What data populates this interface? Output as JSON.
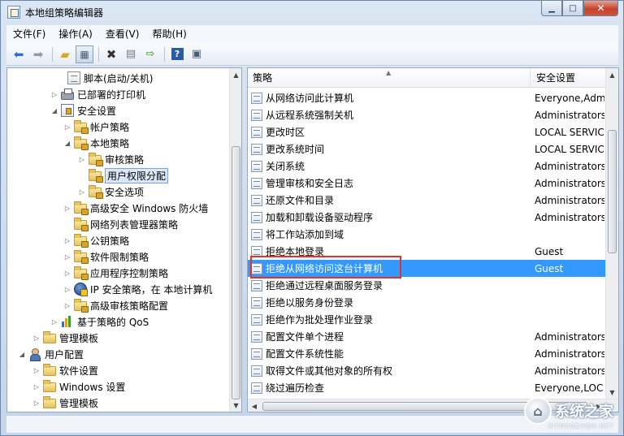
{
  "window": {
    "title": "本地组策略编辑器"
  },
  "menu": [
    {
      "label": "文件(F)"
    },
    {
      "label": "操作(A)"
    },
    {
      "label": "查看(V)"
    },
    {
      "label": "帮助(H)"
    }
  ],
  "toolbar": {
    "buttons": [
      "back-icon",
      "forward-icon",
      "up-folder-icon",
      "show-tree-icon",
      "delete-icon",
      "properties-icon",
      "export-icon",
      "help-icon",
      "view-icon"
    ]
  },
  "tree": {
    "items": [
      {
        "label": "脚本(启动/关机)",
        "icon": "script-icon",
        "arrow": ""
      },
      {
        "label": "已部署的打印机",
        "icon": "printer-icon",
        "arrow": "▷"
      },
      {
        "label": "安全设置",
        "icon": "security-icon",
        "arrow": "◢"
      },
      {
        "label": "帐户策略",
        "icon": "lock-folder-icon",
        "arrow": "▷"
      },
      {
        "label": "本地策略",
        "icon": "lock-folder-icon",
        "arrow": "◢"
      },
      {
        "label": "审核策略",
        "icon": "lock-folder-icon",
        "arrow": "▷"
      },
      {
        "label": "用户权限分配",
        "icon": "lock-folder-icon",
        "arrow": ""
      },
      {
        "label": "安全选项",
        "icon": "lock-folder-icon",
        "arrow": "▷"
      },
      {
        "label": "高级安全 Windows 防火墙",
        "icon": "lock-folder-icon",
        "arrow": "▷"
      },
      {
        "label": "网络列表管理器策略",
        "icon": "lock-folder-icon",
        "arrow": ""
      },
      {
        "label": "公钥策略",
        "icon": "lock-folder-icon",
        "arrow": "▷"
      },
      {
        "label": "软件限制策略",
        "icon": "lock-folder-icon",
        "arrow": "▷"
      },
      {
        "label": "应用程序控制策略",
        "icon": "lock-folder-icon",
        "arrow": "▷"
      },
      {
        "label": "IP 安全策略，在 本地计算机",
        "icon": "ipsec-icon",
        "arrow": "▷"
      },
      {
        "label": "高级审核策略配置",
        "icon": "lock-folder-icon",
        "arrow": "▷"
      },
      {
        "label": "基于策略的 QoS",
        "icon": "chart-icon",
        "arrow": "▷"
      },
      {
        "label": "管理模板",
        "icon": "folder-icon",
        "arrow": "▷"
      },
      {
        "label": "用户配置",
        "icon": "user-icon",
        "arrow": "◢"
      },
      {
        "label": "软件设置",
        "icon": "folder-icon",
        "arrow": "▷"
      },
      {
        "label": "Windows 设置",
        "icon": "folder-icon",
        "arrow": "▷"
      },
      {
        "label": "管理模板",
        "icon": "folder-icon",
        "arrow": "▷"
      }
    ]
  },
  "list": {
    "headers": {
      "policy": "策略",
      "setting": "安全设置"
    },
    "rows": [
      {
        "policy": "从网络访问此计算机",
        "setting": "Everyone,Adm"
      },
      {
        "policy": "从远程系统强制关机",
        "setting": "Administrators"
      },
      {
        "policy": "更改时区",
        "setting": "LOCAL SERVIC"
      },
      {
        "policy": "更改系统时间",
        "setting": "LOCAL SERVIC"
      },
      {
        "policy": "关闭系统",
        "setting": "Administrators"
      },
      {
        "policy": "管理审核和安全日志",
        "setting": "Administrators"
      },
      {
        "policy": "还原文件和目录",
        "setting": "Administrators"
      },
      {
        "policy": "加载和卸载设备驱动程序",
        "setting": "Administrators"
      },
      {
        "policy": "将工作站添加到域",
        "setting": ""
      },
      {
        "policy": "拒绝本地登录",
        "setting": "Guest"
      },
      {
        "policy": "拒绝从网络访问这台计算机",
        "setting": "Guest"
      },
      {
        "policy": "拒绝通过远程桌面服务登录",
        "setting": ""
      },
      {
        "policy": "拒绝以服务身份登录",
        "setting": ""
      },
      {
        "policy": "拒绝作为批处理作业登录",
        "setting": ""
      },
      {
        "policy": "配置文件单个进程",
        "setting": "Administrators"
      },
      {
        "policy": "配置文件系统性能",
        "setting": "Administrators"
      },
      {
        "policy": "取得文件或其他对象的所有权",
        "setting": "Administrators"
      },
      {
        "policy": "绕过遍历检查",
        "setting": "Everyone,LOC"
      }
    ],
    "selected_index": 10
  },
  "watermark": {
    "text": "系统之家",
    "sub": "XITONGZHIJIA.NET"
  },
  "colors": {
    "selection": "#3399ff",
    "highlight_box": "#e0342b"
  }
}
